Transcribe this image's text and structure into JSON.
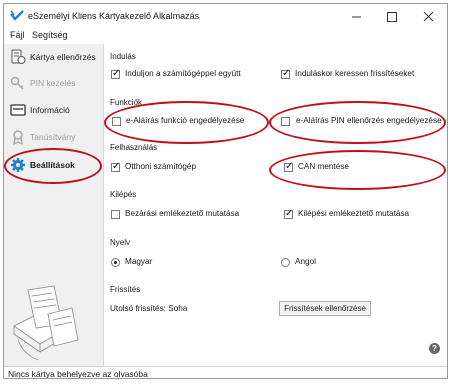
{
  "window": {
    "title": "eSzemélyi Kliens Kártyakezelő Alkalmazás",
    "controls": [
      "minimize",
      "maximize",
      "close"
    ]
  },
  "menu": {
    "items": [
      "Fájl",
      "Segítség"
    ]
  },
  "sidebar": {
    "items": [
      {
        "label": "Kártya ellenőrzés",
        "icon": "card-check-icon",
        "enabled": true
      },
      {
        "label": "PIN kezelés",
        "icon": "key-icon",
        "enabled": false
      },
      {
        "label": "Információ",
        "icon": "card-info-icon",
        "enabled": true
      },
      {
        "label": "Tanúsítvány",
        "icon": "certificate-icon",
        "enabled": false
      },
      {
        "label": "Beállítások",
        "icon": "gear-icon",
        "enabled": true,
        "selected": true
      }
    ]
  },
  "sections": {
    "startup": {
      "title": "Indulás",
      "options": [
        {
          "label": "Induljon a számítógéppel együtt",
          "checked": true
        },
        {
          "label": "Induláskor keressen frissítéseket",
          "checked": true
        }
      ]
    },
    "functions": {
      "title": "Funkciók",
      "options": [
        {
          "label": "e-Aláírás funkció engedélyezése",
          "checked": false
        },
        {
          "label": "e-Aláírás PIN ellenőrzés engedélyezése",
          "checked": false
        }
      ]
    },
    "usage": {
      "title": "Felhasználás",
      "options": [
        {
          "label": "Otthoni számítógép",
          "checked": true
        },
        {
          "label": "CAN mentése",
          "checked": true
        }
      ]
    },
    "exit": {
      "title": "Kilépés",
      "options": [
        {
          "label": "Bezárási emlékeztető mutatása",
          "checked": false
        },
        {
          "label": "Kilépési emlékeztető mutatása",
          "checked": true
        }
      ]
    },
    "language": {
      "title": "Nyelv",
      "options": [
        {
          "label": "Magyar",
          "selected": true
        },
        {
          "label": "Angol",
          "selected": false
        }
      ]
    },
    "update": {
      "title": "Frissítés",
      "last_update": "Utolsó frissítés: Soha",
      "button": "Frissítések ellenőrzése"
    }
  },
  "help": "?",
  "status": "Nincs kártya behelyezve az olvasóba",
  "colors": {
    "highlight": "#c0101a",
    "sidebar_bg": "#f0f0f0",
    "accent": "#1e7fd0"
  }
}
